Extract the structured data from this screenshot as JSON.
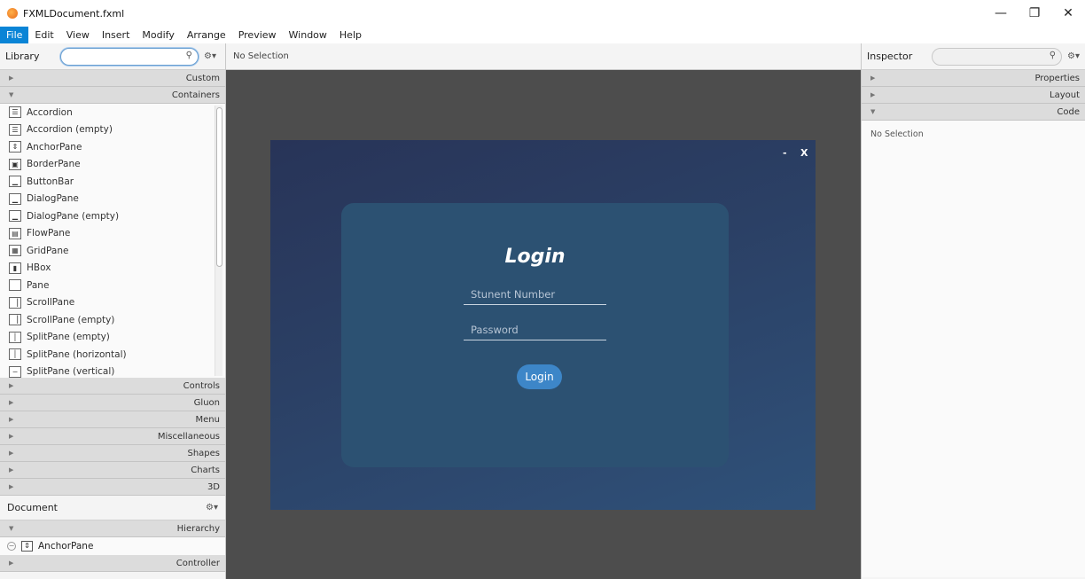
{
  "window": {
    "title": "FXMLDocument.fxml",
    "minimize": "—",
    "restore": "❐",
    "close": "✕"
  },
  "menu": [
    "File",
    "Edit",
    "View",
    "Insert",
    "Modify",
    "Arrange",
    "Preview",
    "Window",
    "Help"
  ],
  "library": {
    "label": "Library",
    "search_value": "",
    "sections_top": [
      {
        "label": "Custom",
        "open": false
      },
      {
        "label": "Containers",
        "open": true
      }
    ],
    "items": [
      {
        "label": "Accordion",
        "icon": "accordion-icon"
      },
      {
        "label": "Accordion  (empty)",
        "icon": "accordion-icon"
      },
      {
        "label": "AnchorPane",
        "icon": "anchorpane-icon"
      },
      {
        "label": "BorderPane",
        "icon": "borderpane-icon"
      },
      {
        "label": "ButtonBar",
        "icon": "buttonbar-icon"
      },
      {
        "label": "DialogPane",
        "icon": "dialogpane-icon"
      },
      {
        "label": "DialogPane  (empty)",
        "icon": "dialogpane-icon"
      },
      {
        "label": "FlowPane",
        "icon": "flowpane-icon"
      },
      {
        "label": "GridPane",
        "icon": "gridpane-icon"
      },
      {
        "label": "HBox",
        "icon": "hbox-icon"
      },
      {
        "label": "Pane",
        "icon": "pane-icon"
      },
      {
        "label": "ScrollPane",
        "icon": "scrollpane-icon"
      },
      {
        "label": "ScrollPane  (empty)",
        "icon": "scrollpane-icon"
      },
      {
        "label": "SplitPane  (empty)",
        "icon": "splitpane-icon"
      },
      {
        "label": "SplitPane  (horizontal)",
        "icon": "splitpane-icon"
      },
      {
        "label": "SplitPane  (vertical)",
        "icon": "splitpane-v-icon"
      }
    ],
    "sections_bottom": [
      "Controls",
      "Gluon",
      "Menu",
      "Miscellaneous",
      "Shapes",
      "Charts",
      "3D"
    ]
  },
  "document": {
    "label": "Document",
    "hierarchy_label": "Hierarchy",
    "root_node": "AnchorPane",
    "controller_label": "Controller"
  },
  "center": {
    "selection_label": "No Selection"
  },
  "stage": {
    "minimize": "-",
    "close": "X",
    "title": "Login",
    "student_placeholder": "Stunent Number",
    "password_placeholder": "Password",
    "login_button": "Login"
  },
  "inspector": {
    "label": "Inspector",
    "sections": [
      {
        "label": "Properties",
        "open": false
      },
      {
        "label": "Layout",
        "open": false
      },
      {
        "label": "Code",
        "open": true
      }
    ],
    "body_text": "No Selection"
  }
}
